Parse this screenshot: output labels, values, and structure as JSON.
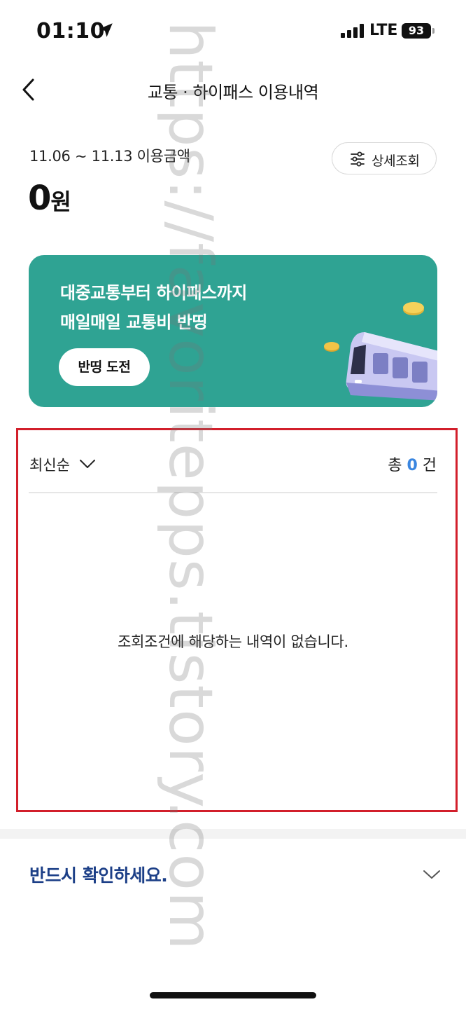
{
  "status_bar": {
    "time": "01:10",
    "network": "LTE",
    "battery": "93"
  },
  "header": {
    "title": "교통 · 하이패스 이용내역"
  },
  "summary": {
    "period_label": "11.06 ~ 11.13 이용금액",
    "amount_value": "0",
    "amount_unit": "원",
    "detail_button": "상세조회"
  },
  "banner": {
    "line1": "대중교통부터 하이패스까지",
    "line2": "매일매일 교통비 반띵",
    "button": "반띵 도전",
    "background_color": "#2fa393"
  },
  "list": {
    "sort_label": "최신순",
    "count_prefix": "총",
    "count_value": "0",
    "count_suffix": "건",
    "empty_message": "조회조건에 해당하는 내역이 없습니다.",
    "highlight_color": "#d21f2b"
  },
  "notice": {
    "title": "반드시 확인하세요."
  },
  "watermark": {
    "text": "https://favoritepps.tistory.com"
  },
  "colors": {
    "accent_blue": "#3a86e0",
    "notice_navy": "#1c3f87"
  }
}
